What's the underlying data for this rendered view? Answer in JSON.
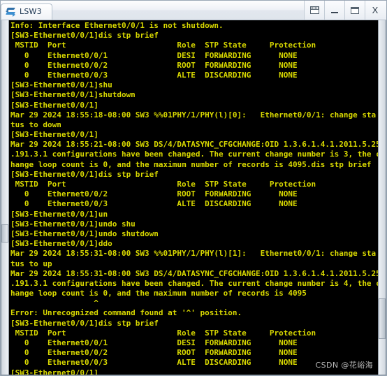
{
  "window": {
    "tab_title": "LSW3",
    "icon": "switch-icon",
    "buttons": {
      "restore_label": "",
      "minimize_label": "",
      "maximize_label": "",
      "close_label": "X"
    },
    "button_names": [
      "restore-window",
      "minimize-window",
      "maximize-window",
      "close-window"
    ]
  },
  "terminal": {
    "foreground_color": "#d8d800",
    "background_color": "#000000",
    "lines": [
      "Info: Interface Ethernet0/0/1 is not shutdown.",
      "[SW3-Ethernet0/0/1]dis stp brief",
      " MSTID  Port                        Role  STP State     Protection",
      "   0    Ethernet0/0/1               DESI  FORWARDING      NONE",
      "   0    Ethernet0/0/2               ROOT  FORWARDING      NONE",
      "   0    Ethernet0/0/3               ALTE  DISCARDING      NONE",
      "[SW3-Ethernet0/0/1]shu",
      "[SW3-Ethernet0/0/1]shutdown",
      "[SW3-Ethernet0/0/1]",
      "Mar 29 2024 18:55:18-08:00 SW3 %%01PHY/1/PHY(l)[0]:   Ethernet0/0/1: change sta",
      "tus to down",
      "[SW3-Ethernet0/0/1]",
      "Mar 29 2024 18:55:21-08:00 SW3 DS/4/DATASYNC_CFGCHANGE:OID 1.3.6.1.4.1.2011.5.25",
      ".191.3.1 configurations have been changed. The current change number is 3, the c",
      "hange loop count is 0, and the maximum number of records is 4095.dis stp brief",
      "[SW3-Ethernet0/0/1]dis stp brief",
      " MSTID  Port                        Role  STP State     Protection",
      "   0    Ethernet0/0/2               ROOT  FORWARDING      NONE",
      "   0    Ethernet0/0/3               ALTE  DISCARDING      NONE",
      "[SW3-Ethernet0/0/1]un",
      "[SW3-Ethernet0/0/1]undo shu",
      "[SW3-Ethernet0/0/1]undo shutdown",
      "[SW3-Ethernet0/0/1]ddo",
      "Mar 29 2024 18:55:31-08:00 SW3 %%01PHY/1/PHY(l)[1]:   Ethernet0/0/1: change sta",
      "tus to up",
      "Mar 29 2024 18:55:31-08:00 SW3 DS/4/DATASYNC_CFGCHANGE:OID 1.3.6.1.4.1.2011.5.25",
      ".191.3.1 configurations have been changed. The current change number is 4, the c",
      "hange loop count is 0, and the maximum number of records is 4095",
      "                  ^",
      "Error: Unrecognized command found at '^' position.",
      "[SW3-Ethernet0/0/1]dis stp brief",
      " MSTID  Port                        Role  STP State     Protection",
      "   0    Ethernet0/0/1               DESI  FORWARDING      NONE",
      "   0    Ethernet0/0/2               ROOT  FORWARDING      NONE",
      "   0    Ethernet0/0/3               ALTE  DISCARDING      NONE",
      "[SW3-Ethernet0/0/1]"
    ],
    "stp_tables": [
      {
        "headers": [
          "MSTID",
          "Port",
          "Role",
          "STP State",
          "Protection"
        ],
        "rows": [
          [
            "0",
            "Ethernet0/0/1",
            "DESI",
            "FORWARDING",
            "NONE"
          ],
          [
            "0",
            "Ethernet0/0/2",
            "ROOT",
            "FORWARDING",
            "NONE"
          ],
          [
            "0",
            "Ethernet0/0/3",
            "ALTE",
            "DISCARDING",
            "NONE"
          ]
        ]
      },
      {
        "headers": [
          "MSTID",
          "Port",
          "Role",
          "STP State",
          "Protection"
        ],
        "rows": [
          [
            "0",
            "Ethernet0/0/2",
            "ROOT",
            "FORWARDING",
            "NONE"
          ],
          [
            "0",
            "Ethernet0/0/3",
            "ALTE",
            "DISCARDING",
            "NONE"
          ]
        ]
      },
      {
        "headers": [
          "MSTID",
          "Port",
          "Role",
          "STP State",
          "Protection"
        ],
        "rows": [
          [
            "0",
            "Ethernet0/0/1",
            "DESI",
            "FORWARDING",
            "NONE"
          ],
          [
            "0",
            "Ethernet0/0/2",
            "ROOT",
            "FORWARDING",
            "NONE"
          ],
          [
            "0",
            "Ethernet0/0/3",
            "ALTE",
            "DISCARDING",
            "NONE"
          ]
        ]
      }
    ],
    "prompt": "[SW3-Ethernet0/0/1]",
    "device_name": "SW3"
  },
  "watermark": {
    "text": "CSDN @花峪海"
  }
}
